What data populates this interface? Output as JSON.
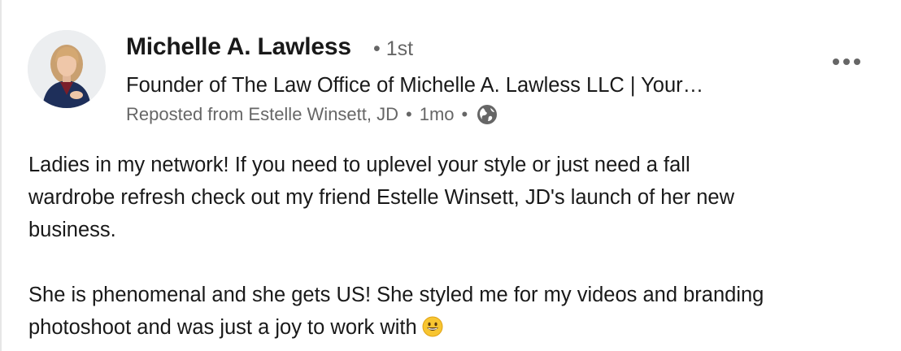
{
  "post": {
    "author": {
      "name": "Michelle A. Lawless",
      "degree": "• 1st",
      "headline": "Founder of The Law Office of Michelle A. Lawless LLC | Your…",
      "avatar_icon": "profile-photo"
    },
    "meta": {
      "reposted_from": "Reposted from Estelle Winsett, JD",
      "time": "1mo",
      "separator": "•",
      "visibility_icon": "globe-icon"
    },
    "more_icon": "ellipsis-icon",
    "paragraphs": [
      "Ladies in my network! If you need to uplevel your style or just need a fall\nwardrobe refresh check out my friend Estelle Winsett, JD's launch of her new\nbusiness.",
      "She is phenomenal and she gets US! She styled me for my videos and branding\nphotoshoot and was just a joy to work with"
    ],
    "emoji_icon": "grinning-face-emoji"
  },
  "colors": {
    "text_primary": "#191919",
    "text_secondary": "#666666",
    "background": "#ffffff"
  }
}
